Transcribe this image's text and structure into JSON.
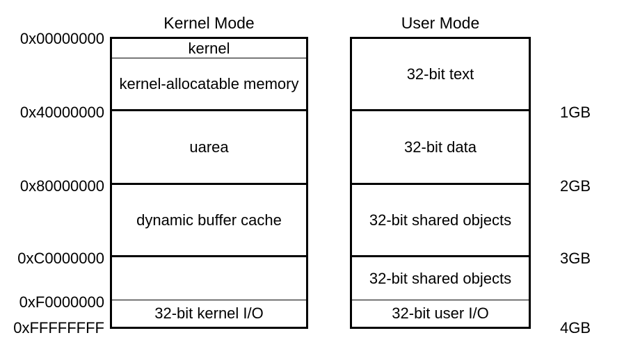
{
  "titles": {
    "kernel": "Kernel Mode",
    "user": "User Mode"
  },
  "addresses": [
    "0x00000000",
    "0x40000000",
    "0x80000000",
    "0xC0000000",
    "0xF0000000",
    "0xFFFFFFFF"
  ],
  "sizes": [
    "1GB",
    "2GB",
    "3GB",
    "4GB"
  ],
  "kernel_segments": {
    "s0": "kernel",
    "s1": "kernel-allocatable memory",
    "s2": "uarea",
    "s3": "dynamic buffer cache",
    "s4": "",
    "s5": "32-bit kernel I/O"
  },
  "user_segments": {
    "s0": "32-bit text",
    "s1": "32-bit data",
    "s2": "32-bit shared objects",
    "s3": "32-bit shared objects",
    "s4": "32-bit user I/O"
  }
}
